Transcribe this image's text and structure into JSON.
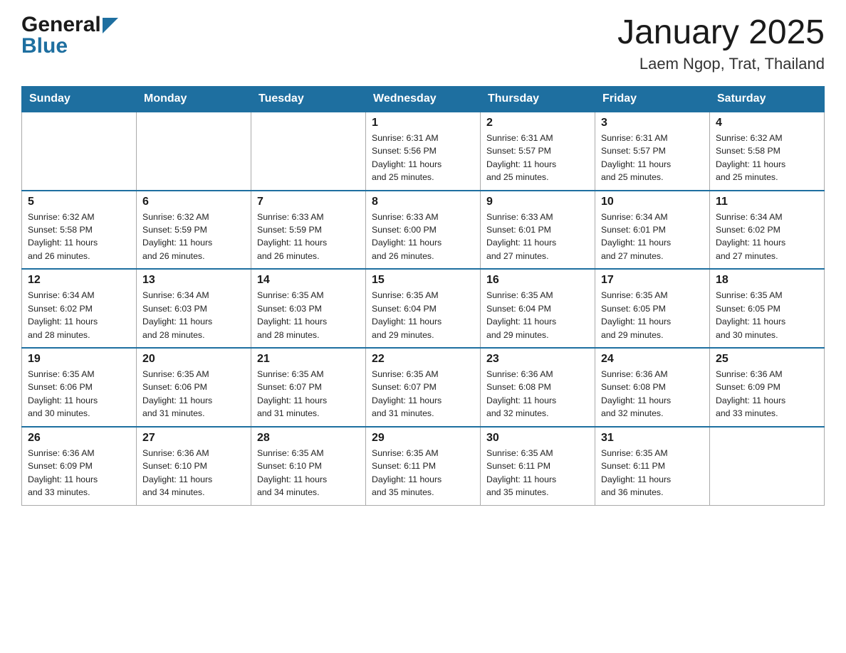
{
  "header": {
    "logo_general": "General",
    "logo_blue": "Blue",
    "month_title": "January 2025",
    "location": "Laem Ngop, Trat, Thailand"
  },
  "days_of_week": [
    "Sunday",
    "Monday",
    "Tuesday",
    "Wednesday",
    "Thursday",
    "Friday",
    "Saturday"
  ],
  "weeks": [
    [
      {
        "day": "",
        "info": ""
      },
      {
        "day": "",
        "info": ""
      },
      {
        "day": "",
        "info": ""
      },
      {
        "day": "1",
        "info": "Sunrise: 6:31 AM\nSunset: 5:56 PM\nDaylight: 11 hours\nand 25 minutes."
      },
      {
        "day": "2",
        "info": "Sunrise: 6:31 AM\nSunset: 5:57 PM\nDaylight: 11 hours\nand 25 minutes."
      },
      {
        "day": "3",
        "info": "Sunrise: 6:31 AM\nSunset: 5:57 PM\nDaylight: 11 hours\nand 25 minutes."
      },
      {
        "day": "4",
        "info": "Sunrise: 6:32 AM\nSunset: 5:58 PM\nDaylight: 11 hours\nand 25 minutes."
      }
    ],
    [
      {
        "day": "5",
        "info": "Sunrise: 6:32 AM\nSunset: 5:58 PM\nDaylight: 11 hours\nand 26 minutes."
      },
      {
        "day": "6",
        "info": "Sunrise: 6:32 AM\nSunset: 5:59 PM\nDaylight: 11 hours\nand 26 minutes."
      },
      {
        "day": "7",
        "info": "Sunrise: 6:33 AM\nSunset: 5:59 PM\nDaylight: 11 hours\nand 26 minutes."
      },
      {
        "day": "8",
        "info": "Sunrise: 6:33 AM\nSunset: 6:00 PM\nDaylight: 11 hours\nand 26 minutes."
      },
      {
        "day": "9",
        "info": "Sunrise: 6:33 AM\nSunset: 6:01 PM\nDaylight: 11 hours\nand 27 minutes."
      },
      {
        "day": "10",
        "info": "Sunrise: 6:34 AM\nSunset: 6:01 PM\nDaylight: 11 hours\nand 27 minutes."
      },
      {
        "day": "11",
        "info": "Sunrise: 6:34 AM\nSunset: 6:02 PM\nDaylight: 11 hours\nand 27 minutes."
      }
    ],
    [
      {
        "day": "12",
        "info": "Sunrise: 6:34 AM\nSunset: 6:02 PM\nDaylight: 11 hours\nand 28 minutes."
      },
      {
        "day": "13",
        "info": "Sunrise: 6:34 AM\nSunset: 6:03 PM\nDaylight: 11 hours\nand 28 minutes."
      },
      {
        "day": "14",
        "info": "Sunrise: 6:35 AM\nSunset: 6:03 PM\nDaylight: 11 hours\nand 28 minutes."
      },
      {
        "day": "15",
        "info": "Sunrise: 6:35 AM\nSunset: 6:04 PM\nDaylight: 11 hours\nand 29 minutes."
      },
      {
        "day": "16",
        "info": "Sunrise: 6:35 AM\nSunset: 6:04 PM\nDaylight: 11 hours\nand 29 minutes."
      },
      {
        "day": "17",
        "info": "Sunrise: 6:35 AM\nSunset: 6:05 PM\nDaylight: 11 hours\nand 29 minutes."
      },
      {
        "day": "18",
        "info": "Sunrise: 6:35 AM\nSunset: 6:05 PM\nDaylight: 11 hours\nand 30 minutes."
      }
    ],
    [
      {
        "day": "19",
        "info": "Sunrise: 6:35 AM\nSunset: 6:06 PM\nDaylight: 11 hours\nand 30 minutes."
      },
      {
        "day": "20",
        "info": "Sunrise: 6:35 AM\nSunset: 6:06 PM\nDaylight: 11 hours\nand 31 minutes."
      },
      {
        "day": "21",
        "info": "Sunrise: 6:35 AM\nSunset: 6:07 PM\nDaylight: 11 hours\nand 31 minutes."
      },
      {
        "day": "22",
        "info": "Sunrise: 6:35 AM\nSunset: 6:07 PM\nDaylight: 11 hours\nand 31 minutes."
      },
      {
        "day": "23",
        "info": "Sunrise: 6:36 AM\nSunset: 6:08 PM\nDaylight: 11 hours\nand 32 minutes."
      },
      {
        "day": "24",
        "info": "Sunrise: 6:36 AM\nSunset: 6:08 PM\nDaylight: 11 hours\nand 32 minutes."
      },
      {
        "day": "25",
        "info": "Sunrise: 6:36 AM\nSunset: 6:09 PM\nDaylight: 11 hours\nand 33 minutes."
      }
    ],
    [
      {
        "day": "26",
        "info": "Sunrise: 6:36 AM\nSunset: 6:09 PM\nDaylight: 11 hours\nand 33 minutes."
      },
      {
        "day": "27",
        "info": "Sunrise: 6:36 AM\nSunset: 6:10 PM\nDaylight: 11 hours\nand 34 minutes."
      },
      {
        "day": "28",
        "info": "Sunrise: 6:35 AM\nSunset: 6:10 PM\nDaylight: 11 hours\nand 34 minutes."
      },
      {
        "day": "29",
        "info": "Sunrise: 6:35 AM\nSunset: 6:11 PM\nDaylight: 11 hours\nand 35 minutes."
      },
      {
        "day": "30",
        "info": "Sunrise: 6:35 AM\nSunset: 6:11 PM\nDaylight: 11 hours\nand 35 minutes."
      },
      {
        "day": "31",
        "info": "Sunrise: 6:35 AM\nSunset: 6:11 PM\nDaylight: 11 hours\nand 36 minutes."
      },
      {
        "day": "",
        "info": ""
      }
    ]
  ]
}
